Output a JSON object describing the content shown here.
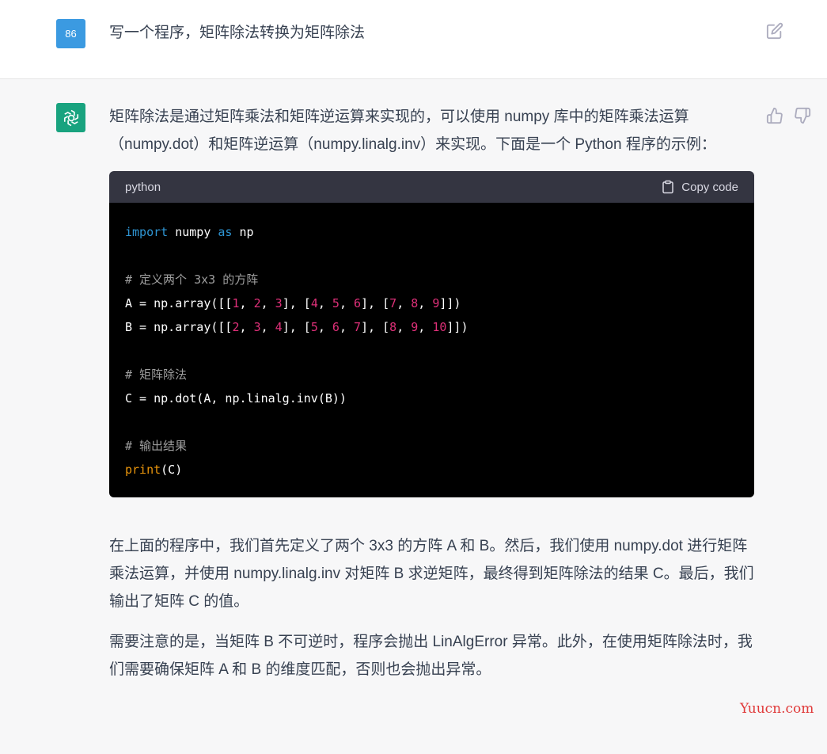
{
  "user": {
    "avatar_text": "86",
    "message": "写一个程序，矩阵除法转换为矩阵除法"
  },
  "assistant": {
    "intro": "矩阵除法是通过矩阵乘法和矩阵逆运算来实现的，可以使用 numpy 库中的矩阵乘法运算（numpy.dot）和矩阵逆运算（numpy.linalg.inv）来实现。下面是一个 Python 程序的示例：",
    "code": {
      "language": "python",
      "copy_label": "Copy code",
      "line1_kw1": "import",
      "line1_mid": " numpy ",
      "line1_kw2": "as",
      "line1_end": " np",
      "comment1": "# 定义两个 3x3 的方阵",
      "a_prefix": "A = np.array([[",
      "b_prefix": "B = np.array([[",
      "comment2": "# 矩阵除法",
      "line_c": "C = np.dot(A, np.linalg.inv(B))",
      "comment3": "# 输出结果",
      "print_kw": "print",
      "print_arg": "(C)"
    },
    "explain1": "在上面的程序中，我们首先定义了两个 3x3 的方阵 A 和 B。然后，我们使用 numpy.dot 进行矩阵乘法运算，并使用 numpy.linalg.inv 对矩阵 B 求逆矩阵，最终得到矩阵除法的结果 C。最后，我们输出了矩阵 C 的值。",
    "explain2": "需要注意的是，当矩阵 B 不可逆时，程序会抛出 LinAlgError 异常。此外，在使用矩阵除法时，我们需要确保矩阵 A 和 B 的维度匹配，否则也会抛出异常。"
  },
  "matrix_a": [
    [
      "1",
      "2",
      "3"
    ],
    [
      "4",
      "5",
      "6"
    ],
    [
      "7",
      "8",
      "9"
    ]
  ],
  "matrix_b": [
    [
      "2",
      "3",
      "4"
    ],
    [
      "5",
      "6",
      "7"
    ],
    [
      "8",
      "9",
      "10"
    ]
  ],
  "watermark": "Yuucn.com",
  "colors": {
    "user_avatar": "#3b9ae1",
    "assistant_avatar": "#19a37f",
    "code_keyword": "#2e95d3",
    "code_number": "#df3079",
    "code_print": "#e9950c"
  }
}
